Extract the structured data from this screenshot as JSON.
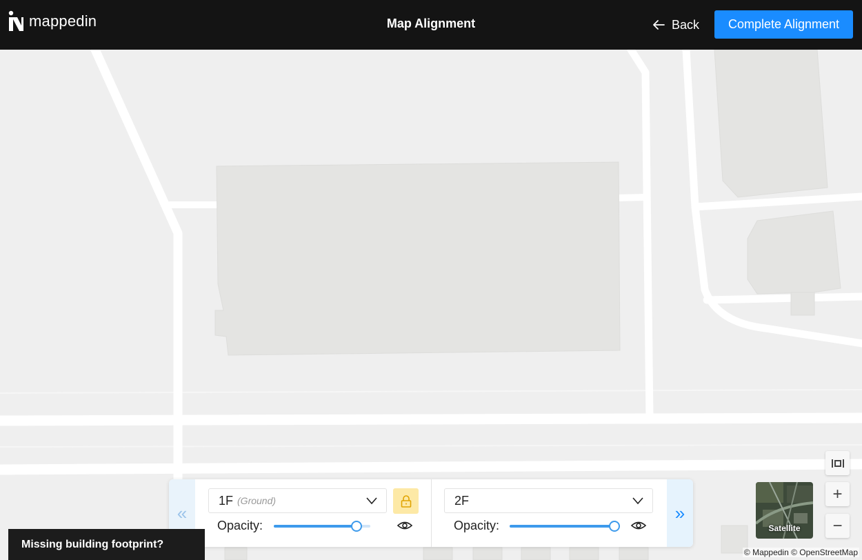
{
  "header": {
    "logo_text": "mappedin",
    "title": "Map Alignment",
    "back_label": "Back",
    "complete_label": "Complete Alignment"
  },
  "floors": {
    "left": {
      "name": "1F",
      "sub": "(Ground)",
      "opacity_label": "Opacity:",
      "opacity_value": 0.9,
      "locked": true
    },
    "right": {
      "name": "2F",
      "opacity_label": "Opacity:",
      "opacity_value": 1.0
    },
    "prev_icon": "«",
    "next_icon": "»"
  },
  "banner": {
    "text": "Missing building footprint?"
  },
  "map_controls": {
    "satellite_label": "Satellite",
    "zoom_in": "+",
    "zoom_out": "−"
  },
  "attribution": "© Mappedin © OpenStreetMap",
  "colors": {
    "accent": "#1a8cff",
    "header_bg": "#141414",
    "map_bg": "#efefef",
    "building": "#e4e4e2",
    "road": "#ffffff",
    "lock_bg": "#fde9a6"
  },
  "icons": [
    "arrow-left-icon",
    "chevron-down-icon",
    "lock-icon",
    "eye-icon",
    "fit-bounds-icon"
  ]
}
